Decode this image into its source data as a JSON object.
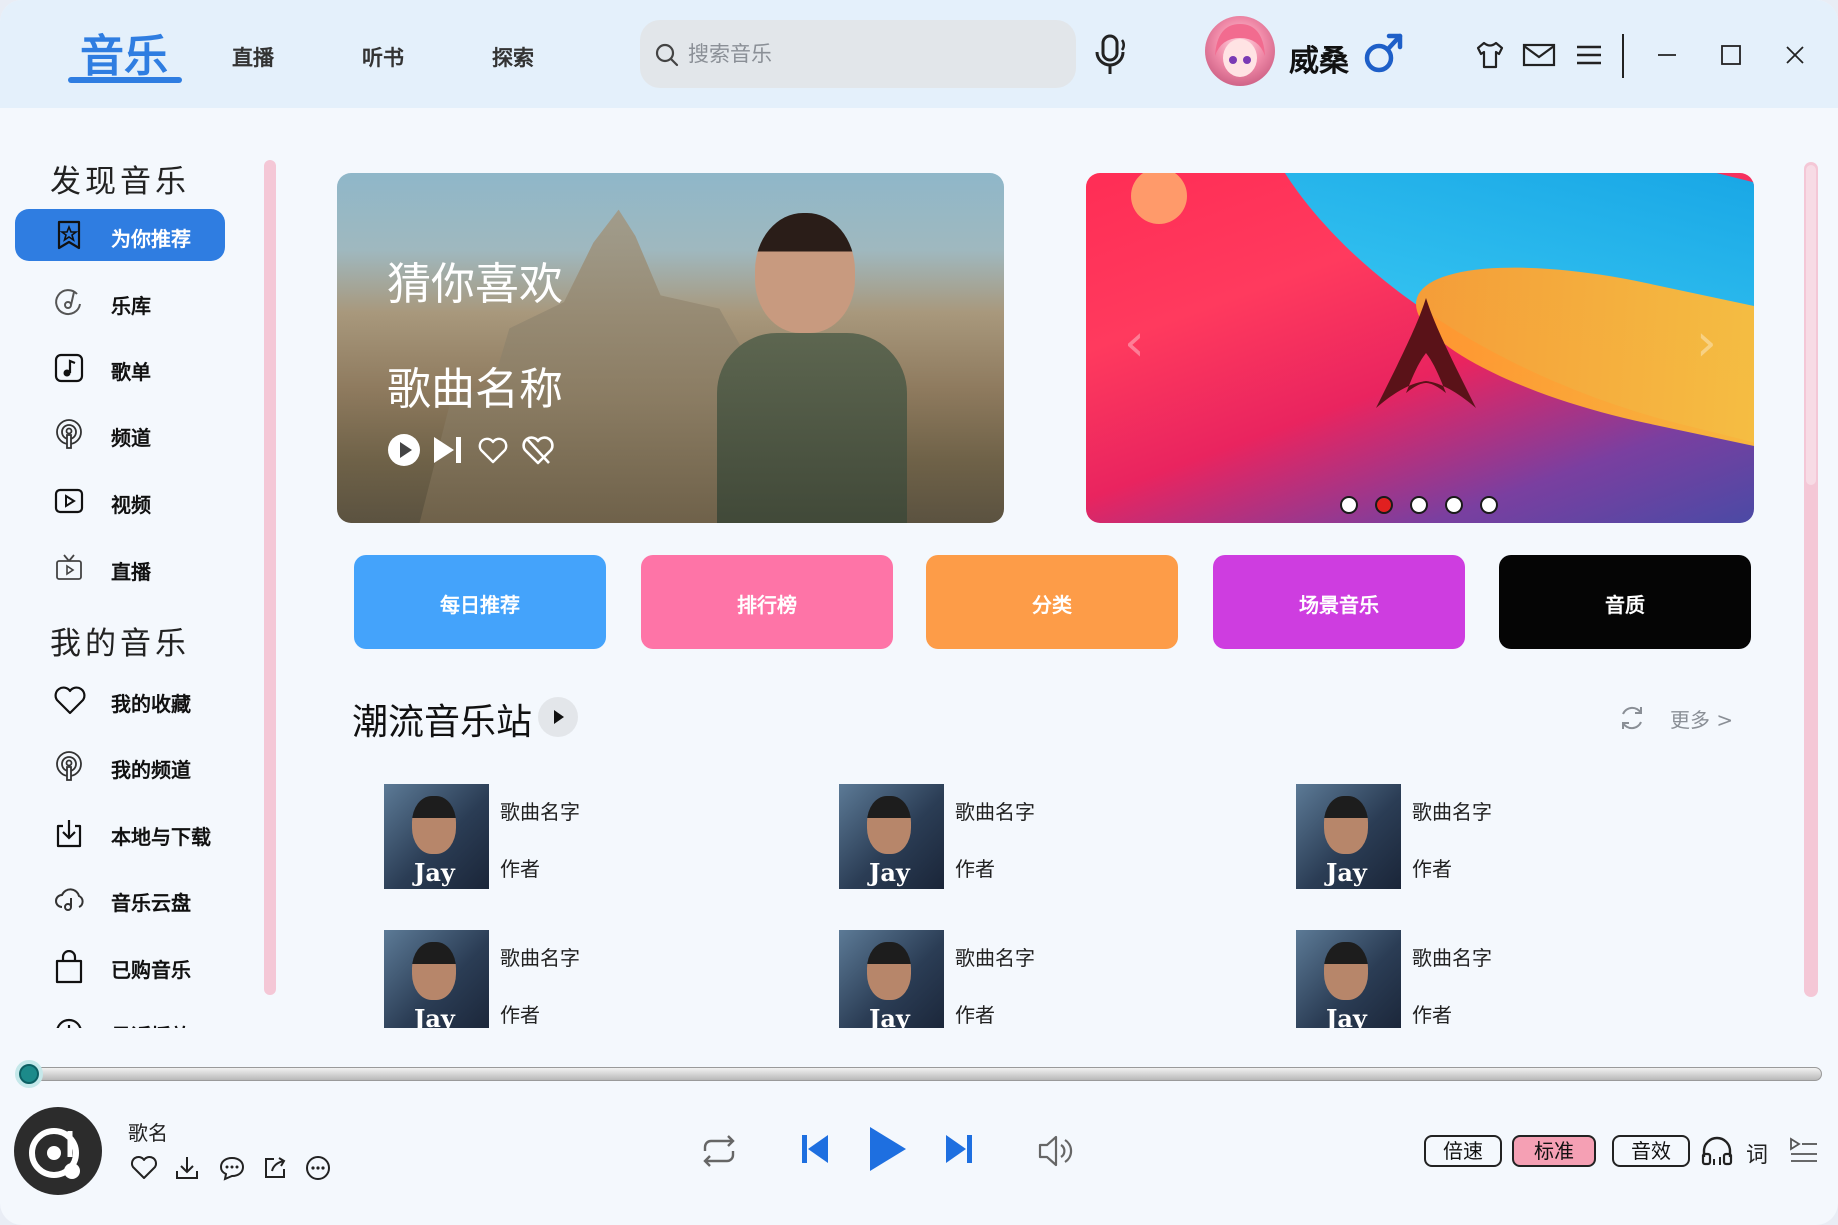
{
  "header": {
    "brand": "音乐",
    "tabs": [
      "直播",
      "听书",
      "探索"
    ],
    "search_placeholder": "搜索音乐",
    "username": "威桑",
    "gender_symbol": "♂"
  },
  "sidebar": {
    "discover_title": "发现音乐",
    "discover_items": [
      {
        "label": "为你推荐",
        "icon": "star-bookmark-icon",
        "active": true
      },
      {
        "label": "乐库",
        "icon": "music-disc-icon"
      },
      {
        "label": "歌单",
        "icon": "playlist-icon"
      },
      {
        "label": "频道",
        "icon": "podcast-icon"
      },
      {
        "label": "视频",
        "icon": "video-icon"
      },
      {
        "label": "直播",
        "icon": "tv-icon"
      }
    ],
    "my_title": "我的音乐",
    "my_items": [
      {
        "label": "我的收藏",
        "icon": "heart-icon"
      },
      {
        "label": "我的频道",
        "icon": "podcast-icon"
      },
      {
        "label": "本地与下载",
        "icon": "download-icon"
      },
      {
        "label": "音乐云盘",
        "icon": "cloud-icon"
      },
      {
        "label": "已购音乐",
        "icon": "shopping-bag-icon"
      },
      {
        "label": "最近播放",
        "icon": "clock-icon"
      }
    ]
  },
  "banner_left": {
    "line1": "猜你喜欢",
    "line2": "歌曲名称"
  },
  "banner_right": {
    "dots": 5,
    "active_dot": 1
  },
  "categories": [
    {
      "label": "每日推荐",
      "color": "#44a3fb"
    },
    {
      "label": "排行榜",
      "color": "#fe74a7"
    },
    {
      "label": "分类",
      "color": "#fd9c48"
    },
    {
      "label": "场景音乐",
      "color": "#ce3de0"
    },
    {
      "label": "音质",
      "color": "#050505"
    }
  ],
  "section": {
    "title": "潮流音乐站",
    "more": "更多 >"
  },
  "songs": [
    {
      "name": "歌曲名字",
      "artist": "作者",
      "cover_text": "Jay"
    },
    {
      "name": "歌曲名字",
      "artist": "作者",
      "cover_text": "Jay"
    },
    {
      "name": "歌曲名字",
      "artist": "作者",
      "cover_text": "Jay"
    },
    {
      "name": "歌曲名字",
      "artist": "作者",
      "cover_text": "Jay"
    },
    {
      "name": "歌曲名字",
      "artist": "作者",
      "cover_text": "Jay"
    },
    {
      "name": "歌曲名字",
      "artist": "作者",
      "cover_text": "Jay"
    }
  ],
  "player": {
    "song_name": "歌名",
    "progress": 0,
    "speed_label": "倍速",
    "quality_label": "标准",
    "effect_label": "音效",
    "lyric_label": "词"
  },
  "colors": {
    "accent": "#2f7de1",
    "scrollbar": "#f4c7d6"
  }
}
